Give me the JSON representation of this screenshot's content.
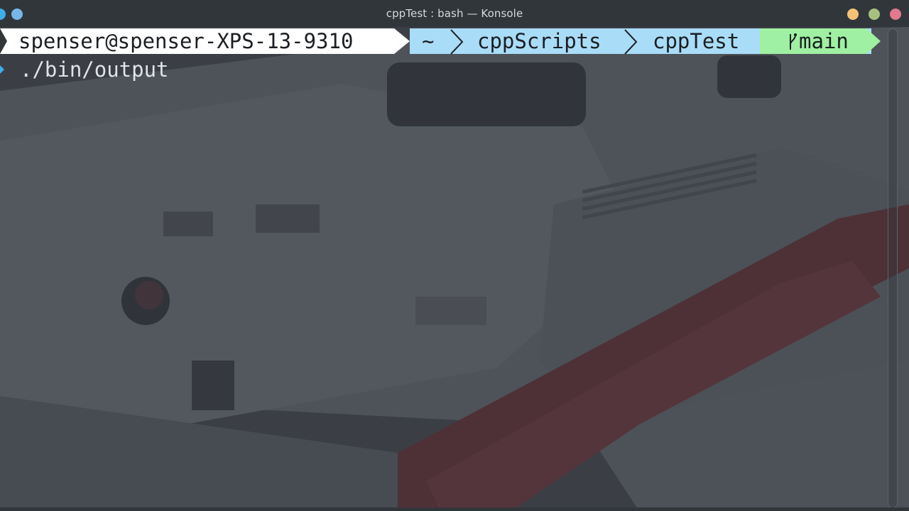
{
  "window": {
    "title": "cppTest : bash — Konsole"
  },
  "prompt": {
    "user_host": "spenser@spenser-XPS-13-9310",
    "path": [
      "~",
      "cppScripts",
      "cppTest"
    ],
    "branch_icon": "git-branch-icon",
    "branch": "main"
  },
  "command": {
    "text": "./bin/output"
  },
  "colors": {
    "user_segment": "#ffffff",
    "path_segment": "#a9dcf7",
    "branch_segment": "#9ff0a2",
    "minimize": "#f6c177",
    "maximize": "#a7c080",
    "close": "#e07a8c",
    "accent": "#3daee9"
  }
}
